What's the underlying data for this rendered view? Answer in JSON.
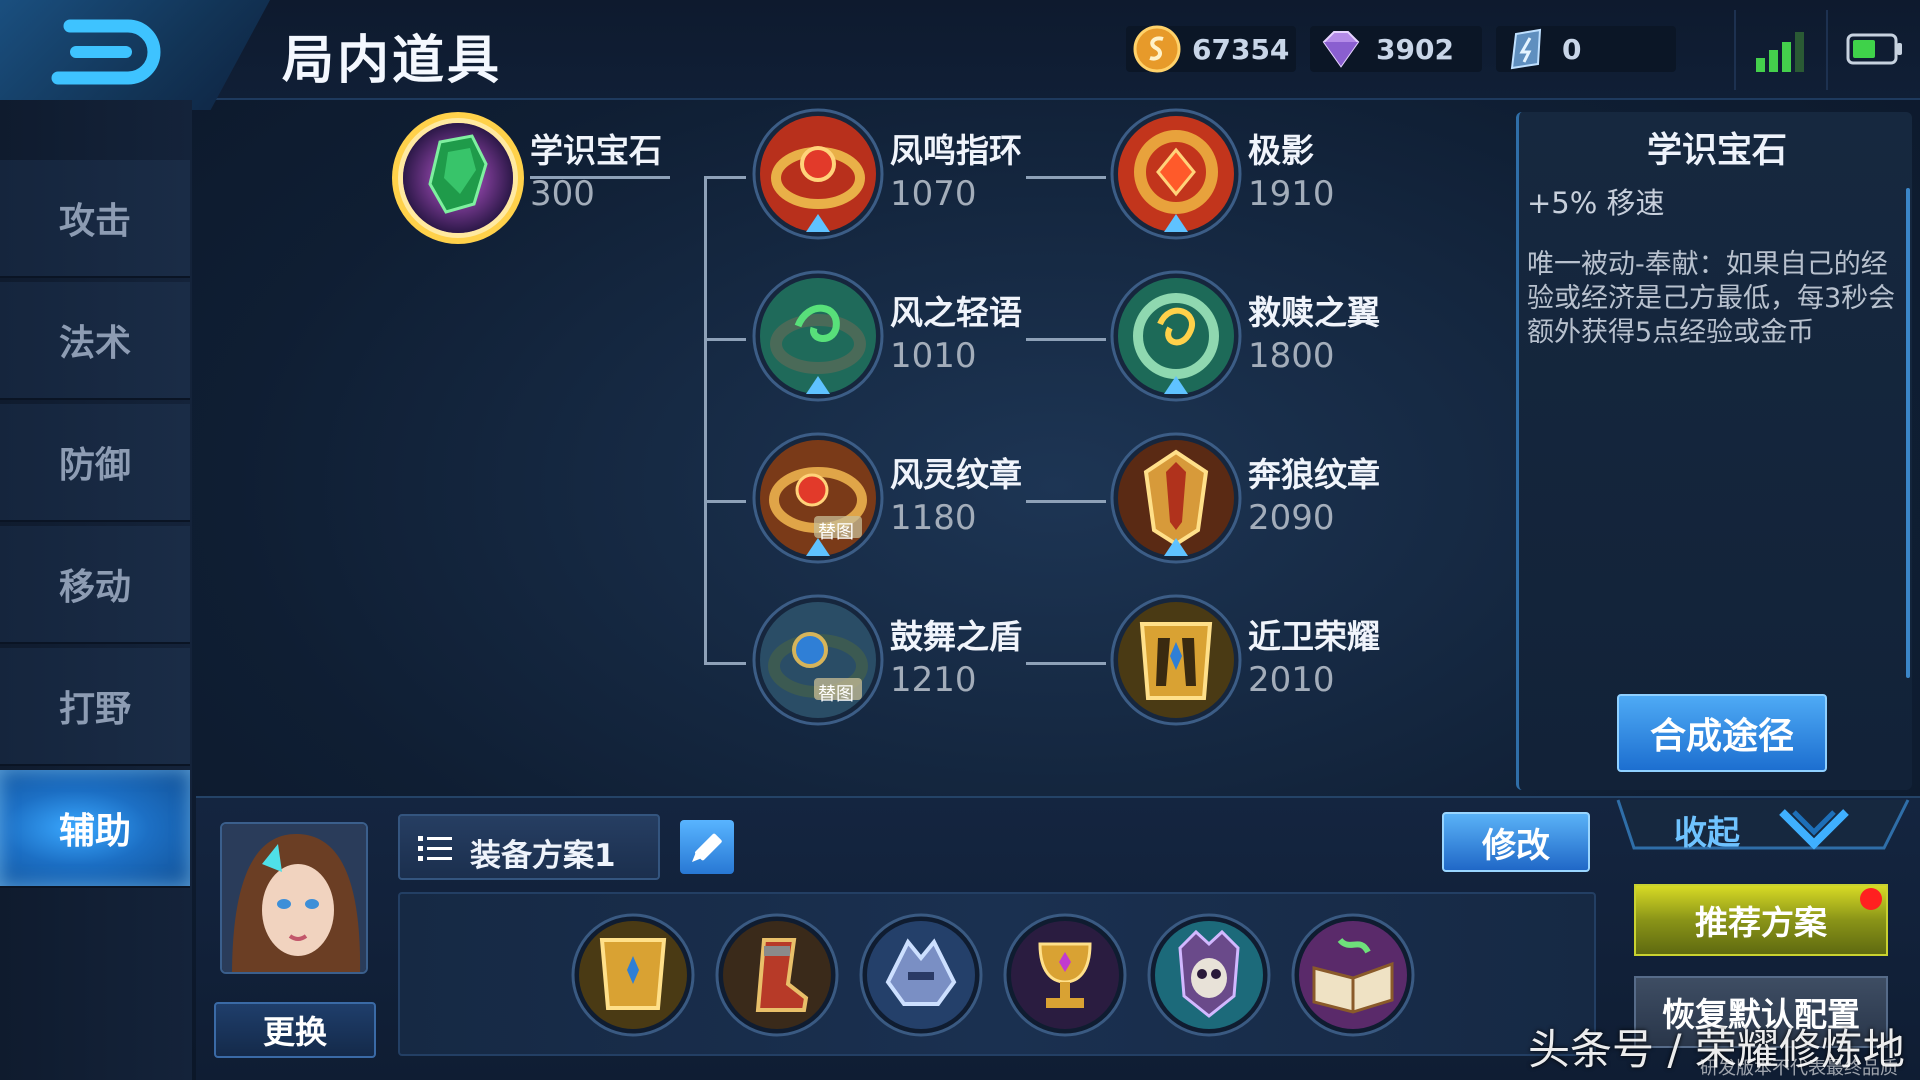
{
  "header": {
    "title": "局内道具"
  },
  "currencies": [
    {
      "icon": "gold-coin-icon",
      "value": "67354"
    },
    {
      "icon": "diamond-icon",
      "value": "3902"
    },
    {
      "icon": "crystal-voucher-icon",
      "value": "0"
    }
  ],
  "sidebar": {
    "items": [
      {
        "label": "攻击",
        "active": false
      },
      {
        "label": "法术",
        "active": false
      },
      {
        "label": "防御",
        "active": false
      },
      {
        "label": "移动",
        "active": false
      },
      {
        "label": "打野",
        "active": false
      },
      {
        "label": "辅助",
        "active": true
      }
    ]
  },
  "tree": {
    "root": {
      "name": "学识宝石",
      "price": "300"
    },
    "tier2": [
      {
        "name": "凤鸣指环",
        "price": "1070",
        "badge": ""
      },
      {
        "name": "风之轻语",
        "price": "1010",
        "badge": ""
      },
      {
        "name": "风灵纹章",
        "price": "1180",
        "badge": "替图"
      },
      {
        "name": "鼓舞之盾",
        "price": "1210",
        "badge": "替图"
      }
    ],
    "tier3": [
      {
        "name": "极影",
        "price": "1910"
      },
      {
        "name": "救赎之翼",
        "price": "1800"
      },
      {
        "name": "奔狼纹章",
        "price": "2090"
      },
      {
        "name": "近卫荣耀",
        "price": "2010"
      }
    ]
  },
  "info": {
    "title": "学识宝石",
    "stat": "+5% 移速",
    "description": "唯一被动-奉献：如果自己的经验或经济是己方最低，每3秒会额外获得5点经验或金币",
    "synth_button": "合成途径"
  },
  "bottom": {
    "swap_button": "更换",
    "plan_label": "装备方案1",
    "modify_button": "修改",
    "collapse_label": "收起",
    "recommend_button": "推荐方案",
    "restore_button": "恢复默认配置",
    "equip_slots": [
      "guard-glory-icon",
      "boots-icon",
      "helmet-icon",
      "goblet-icon",
      "skull-mask-icon",
      "spellbook-icon"
    ]
  },
  "colors": {
    "accent": "#3aa8ff",
    "gold": "#e7b64a",
    "recommend": "#c9d230",
    "alert": "#ff2020"
  },
  "watermark": {
    "main": "头条号 / 荣耀修炼地",
    "sub": "研发版本不代表最终品质"
  }
}
